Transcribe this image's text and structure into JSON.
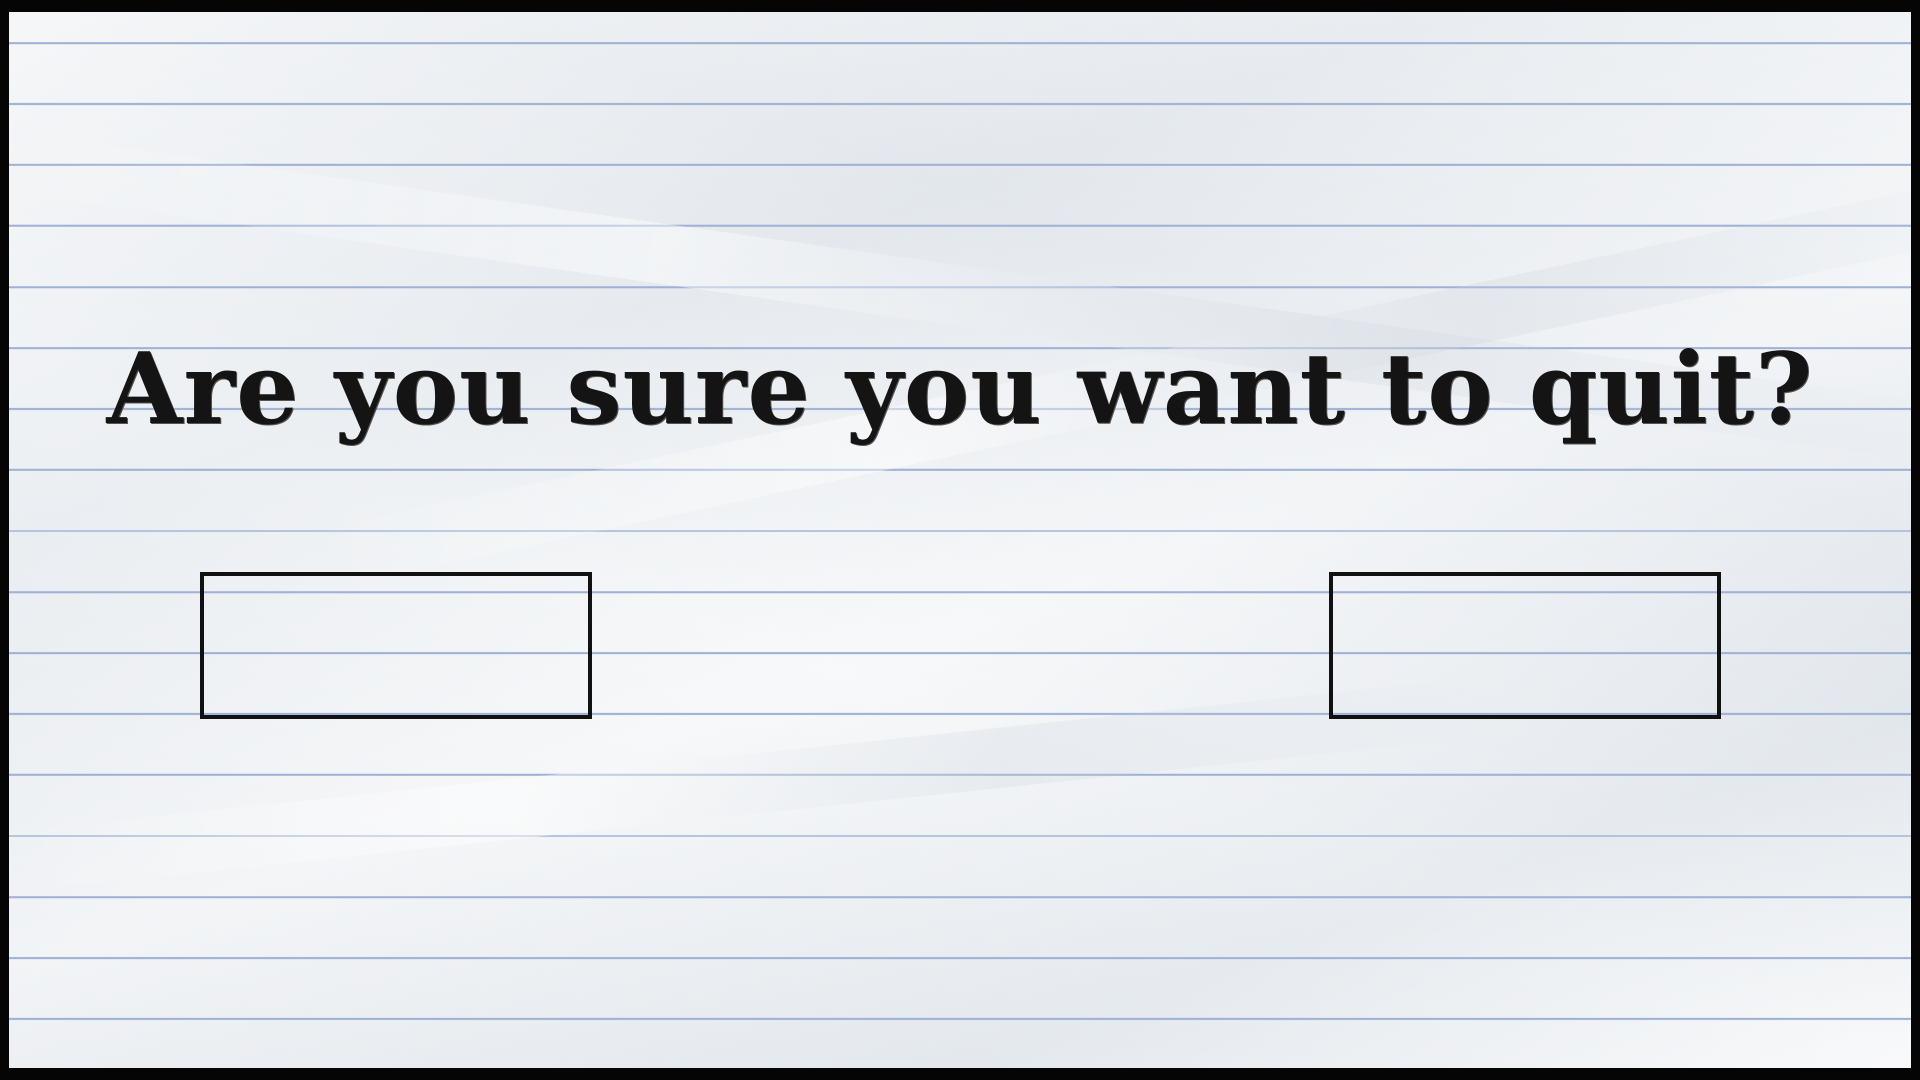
{
  "dialog": {
    "question": "Are you sure you want to quit?",
    "options": [
      "",
      ""
    ]
  },
  "colors": {
    "frame": "#050505",
    "paper": "#eef1f4",
    "rule_line": "#9fb2d6",
    "ink": "#141414"
  }
}
